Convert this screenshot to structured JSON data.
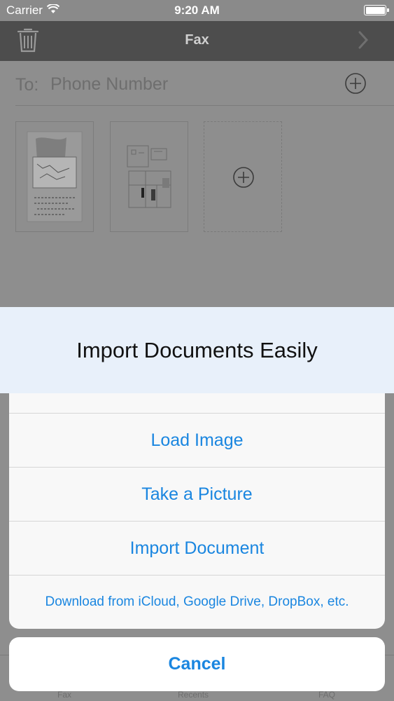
{
  "status_bar": {
    "carrier": "Carrier",
    "time": "9:20 AM"
  },
  "nav_bar": {
    "title": "Fax"
  },
  "to_row": {
    "label": "To:",
    "placeholder": "Phone Number"
  },
  "tabs": [
    "Fax",
    "Recents",
    "FAQ"
  ],
  "banner": {
    "text": "Import Documents Easily"
  },
  "action_sheet": {
    "options": [
      "",
      "Load Image",
      "Take a Picture",
      "Import Document",
      "Download from iCloud, Google Drive, DropBox, etc."
    ],
    "cancel_label": "Cancel"
  },
  "colors": {
    "accent": "#1a86e0",
    "nav_background": "#4d4d4d",
    "banner_background": "#e8f0fa"
  },
  "icons": [
    "wifi-icon",
    "battery-icon",
    "trash-icon",
    "chevron-right-icon",
    "add-contact-icon",
    "add-page-icon"
  ]
}
